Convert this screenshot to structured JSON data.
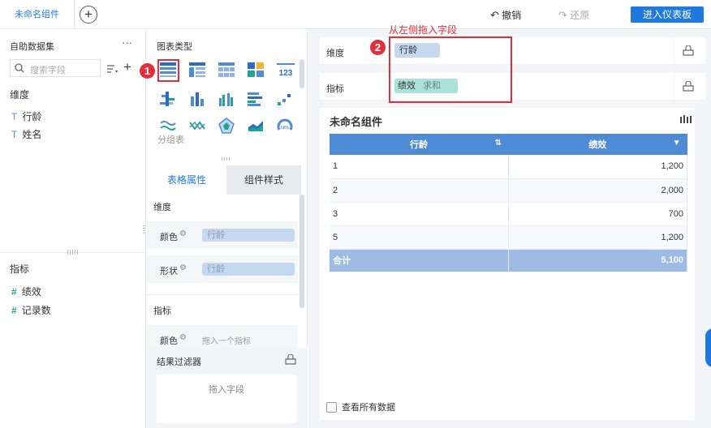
{
  "topbar": {
    "tab_label": "未命名组件",
    "add_label": "+",
    "undo_label": "撤销",
    "redo_label": "还原",
    "enter_label": "进入仪表板"
  },
  "dataset": {
    "title": "自助数据集",
    "more_label": "···",
    "search_placeholder": "搜索字段",
    "add_label": "+",
    "dimension_header": "维度",
    "dimensions": [
      {
        "glyph": "T",
        "label": "行龄"
      },
      {
        "glyph": "T",
        "label": "姓名"
      }
    ],
    "measure_header": "指标",
    "measures": [
      {
        "glyph": "#",
        "label": "绩效"
      },
      {
        "glyph": "#",
        "label": "记录数"
      }
    ]
  },
  "chart_types": {
    "title": "图表类型",
    "grouped_label": "分组表"
  },
  "properties": {
    "tab_properties": "表格属性",
    "tab_style": "组件样式",
    "dimension_header": "维度",
    "color_label": "颜色",
    "color_value": "行龄",
    "shape_label": "形状",
    "shape_value": "行龄",
    "measure_header": "指标",
    "measure_color_label": "颜色",
    "measure_color_placeholder": "拖入一个指标",
    "filter_title": "结果过滤器",
    "filter_placeholder": "拖入字段"
  },
  "shelf": {
    "dimension_label": "维度",
    "dimension_field": "行龄",
    "measure_label": "指标",
    "measure_field": "绩效",
    "measure_agg": "求和"
  },
  "annotations": {
    "badge1": "1",
    "badge2": "2",
    "hint": "从左侧拖入字段"
  },
  "widget": {
    "title": "未命名组件",
    "show_all_label": "查看所有数据"
  },
  "table": {
    "headers": [
      "行龄",
      "绩效"
    ],
    "rows": [
      [
        "1",
        "1,200"
      ],
      [
        "2",
        "2,000"
      ],
      [
        "3",
        "700"
      ],
      [
        "5",
        "1,200"
      ]
    ],
    "total": [
      "合计",
      "5,100"
    ]
  },
  "colors": {
    "accent": "#1f7ae0",
    "header_blue": "#4f8cd5",
    "total_blue": "#9ebbe6",
    "annotation_red": "#e0303a",
    "dimension_pill": "#c6d7f0",
    "measure_pill": "#a8e2d8"
  }
}
